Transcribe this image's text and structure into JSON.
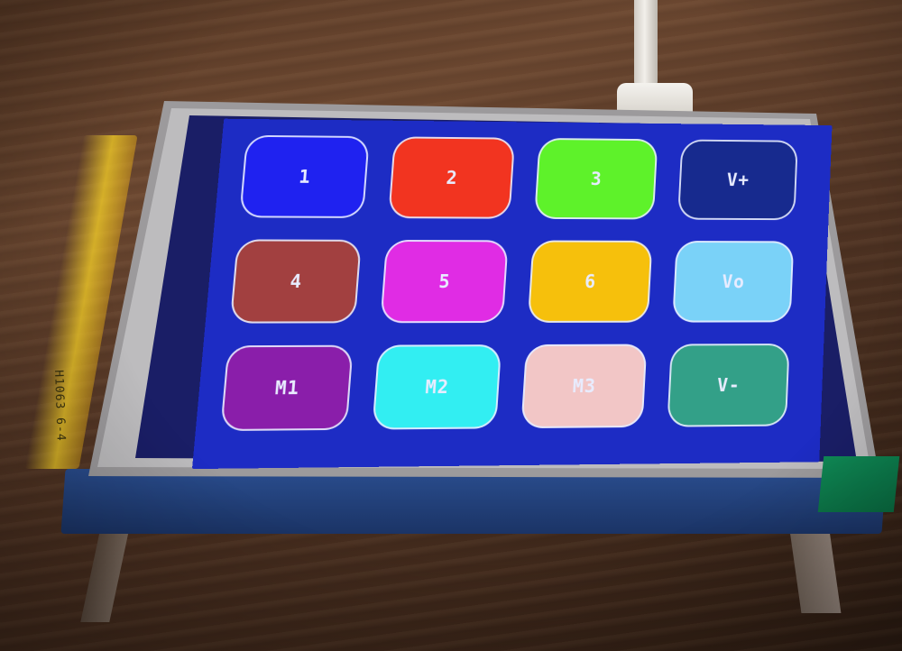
{
  "flex_cable_label": "H1063 6-4",
  "screen_bg": "#1d2cc4",
  "keypad": {
    "rows": [
      [
        {
          "label": "1",
          "color": "#1f22f0"
        },
        {
          "label": "2",
          "color": "#f23420"
        },
        {
          "label": "3",
          "color": "#5ef22a"
        },
        {
          "label": "V+",
          "color": "#172a8e"
        }
      ],
      [
        {
          "label": "4",
          "color": "#a24040"
        },
        {
          "label": "5",
          "color": "#e02ce4"
        },
        {
          "label": "6",
          "color": "#f6c00c"
        },
        {
          "label": "Vo",
          "color": "#7ad2f8"
        }
      ],
      [
        {
          "label": "M1",
          "color": "#8a1eaa"
        },
        {
          "label": "M2",
          "color": "#32eef2"
        },
        {
          "label": "M3",
          "color": "#f2c6c6"
        },
        {
          "label": "V-",
          "color": "#33a088"
        }
      ]
    ]
  }
}
